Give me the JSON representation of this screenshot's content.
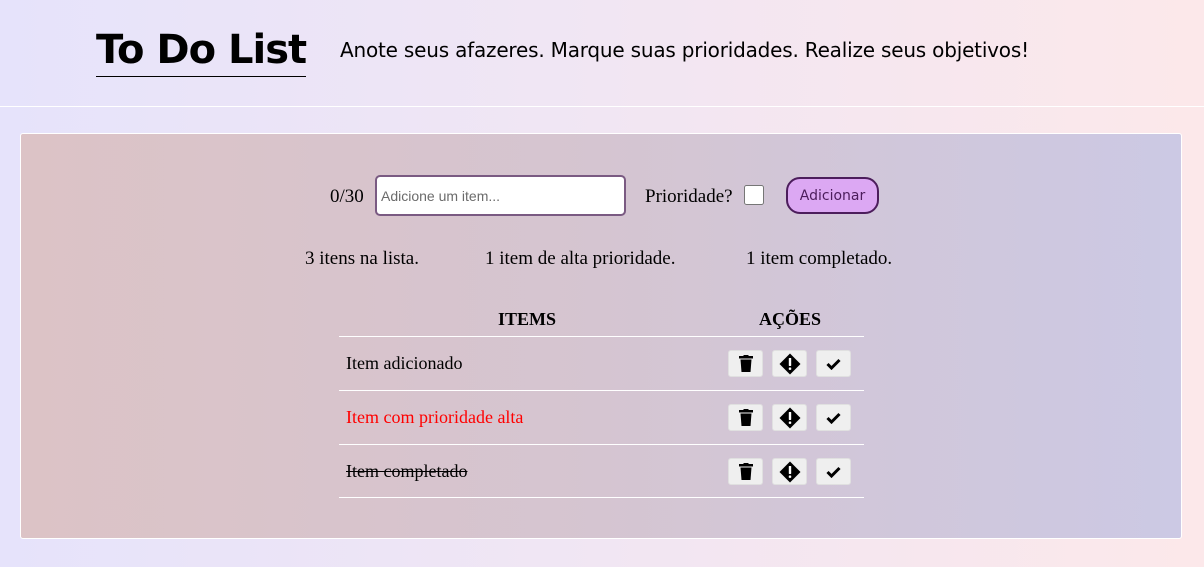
{
  "header": {
    "title": "To Do List",
    "subtitle": "Anote seus afazeres. Marque suas prioridades. Realize seus objetivos!"
  },
  "form": {
    "counter": "0/30",
    "input_placeholder": "Adicione um item...",
    "priority_label": "Prioridade?",
    "priority_checked": false,
    "add_button": "Adicionar"
  },
  "stats": {
    "total": "3 itens na lista.",
    "high_priority": "1 item de alta prioridade.",
    "completed": "1 item completado."
  },
  "table": {
    "headers": [
      "ITEMS",
      "AÇÕES"
    ],
    "rows": [
      {
        "text": "Item adicionado",
        "priority": false,
        "completed": false
      },
      {
        "text": "Item com prioridade alta",
        "priority": true,
        "completed": false
      },
      {
        "text": "Item completado",
        "priority": false,
        "completed": true
      }
    ],
    "action_icons": [
      "trash-icon",
      "priority-diamond-icon",
      "check-icon"
    ]
  },
  "colors": {
    "high_priority_text": "#ff0000",
    "add_button_bg": "#dca8f3",
    "add_button_border": "#4c1d5c",
    "input_border": "#7a5a82"
  }
}
